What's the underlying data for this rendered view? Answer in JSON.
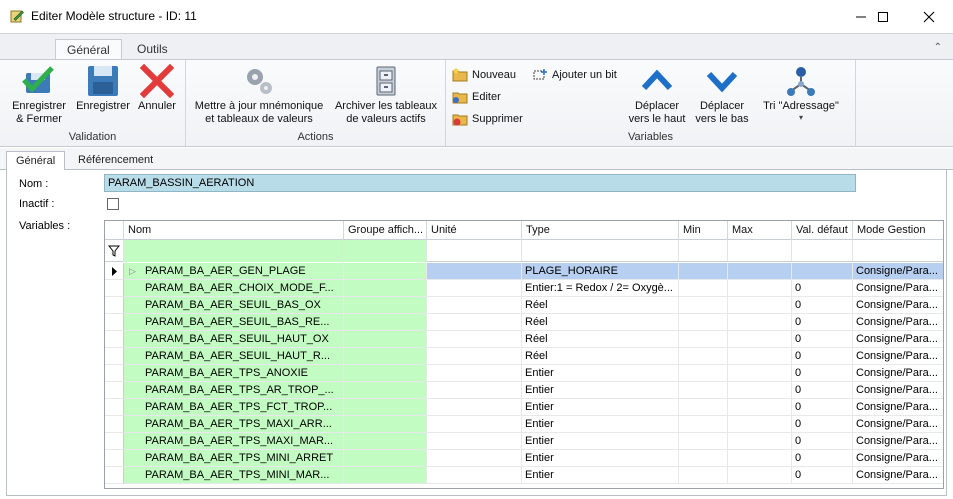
{
  "window": {
    "title": "Editer Modèle structure - ID: 11"
  },
  "ribbon": {
    "tabs": [
      "Général",
      "Outils"
    ],
    "groups": {
      "validation": {
        "label": "Validation",
        "save_close": "Enregistrer\n& Fermer",
        "save": "Enregistrer",
        "cancel": "Annuler"
      },
      "actions": {
        "label": "Actions",
        "update": "Mettre à jour mnémonique\net tableaux de valeurs",
        "archive": "Archiver les tableaux\nde valeurs actifs"
      },
      "variables": {
        "label": "Variables",
        "new": "Nouveau",
        "edit": "Editer",
        "delete": "Supprimer",
        "add_bit": "Ajouter un bit",
        "move_up": "Déplacer\nvers le haut",
        "move_down": "Déplacer\nvers le bas",
        "sort": "Tri \"Adressage\""
      }
    }
  },
  "subtabs": [
    "Général",
    "Référencement"
  ],
  "form": {
    "name_label": "Nom :",
    "name_value": "PARAM_BASSIN_AERATION",
    "inactive_label": "Inactif :",
    "variables_label": "Variables :"
  },
  "grid": {
    "columns": [
      "Nom",
      "Groupe affich...",
      "Unité",
      "Type",
      "Min",
      "Max",
      "Val. défaut",
      "Mode Gestion"
    ],
    "rows": [
      {
        "nom": "PARAM_BA_AER_GEN_PLAGE",
        "groupe": "",
        "unite": "",
        "type": "PLAGE_HORAIRE",
        "min": "",
        "max": "",
        "defaut": "",
        "mode": "Consigne/Para..."
      },
      {
        "nom": "PARAM_BA_AER_CHOIX_MODE_F...",
        "groupe": "",
        "unite": "",
        "type": "Entier:1 = Redox / 2= Oxygè...",
        "min": "",
        "max": "",
        "defaut": "0",
        "mode": "Consigne/Para..."
      },
      {
        "nom": "PARAM_BA_AER_SEUIL_BAS_OX",
        "groupe": "",
        "unite": "",
        "type": "Réel",
        "min": "",
        "max": "",
        "defaut": "0",
        "mode": "Consigne/Para..."
      },
      {
        "nom": "PARAM_BA_AER_SEUIL_BAS_RE...",
        "groupe": "",
        "unite": "",
        "type": "Réel",
        "min": "",
        "max": "",
        "defaut": "0",
        "mode": "Consigne/Para..."
      },
      {
        "nom": "PARAM_BA_AER_SEUIL_HAUT_OX",
        "groupe": "",
        "unite": "",
        "type": "Réel",
        "min": "",
        "max": "",
        "defaut": "0",
        "mode": "Consigne/Para..."
      },
      {
        "nom": "PARAM_BA_AER_SEUIL_HAUT_R...",
        "groupe": "",
        "unite": "",
        "type": "Réel",
        "min": "",
        "max": "",
        "defaut": "0",
        "mode": "Consigne/Para..."
      },
      {
        "nom": "PARAM_BA_AER_TPS_ANOXIE",
        "groupe": "",
        "unite": "",
        "type": "Entier",
        "min": "",
        "max": "",
        "defaut": "0",
        "mode": "Consigne/Para..."
      },
      {
        "nom": "PARAM_BA_AER_TPS_AR_TROP_...",
        "groupe": "",
        "unite": "",
        "type": "Entier",
        "min": "",
        "max": "",
        "defaut": "0",
        "mode": "Consigne/Para..."
      },
      {
        "nom": "PARAM_BA_AER_TPS_FCT_TROP...",
        "groupe": "",
        "unite": "",
        "type": "Entier",
        "min": "",
        "max": "",
        "defaut": "0",
        "mode": "Consigne/Para..."
      },
      {
        "nom": "PARAM_BA_AER_TPS_MAXI_ARR...",
        "groupe": "",
        "unite": "",
        "type": "Entier",
        "min": "",
        "max": "",
        "defaut": "0",
        "mode": "Consigne/Para..."
      },
      {
        "nom": "PARAM_BA_AER_TPS_MAXI_MAR...",
        "groupe": "",
        "unite": "",
        "type": "Entier",
        "min": "",
        "max": "",
        "defaut": "0",
        "mode": "Consigne/Para..."
      },
      {
        "nom": "PARAM_BA_AER_TPS_MINI_ARRET",
        "groupe": "",
        "unite": "",
        "type": "Entier",
        "min": "",
        "max": "",
        "defaut": "0",
        "mode": "Consigne/Para..."
      },
      {
        "nom": "PARAM_BA_AER_TPS_MINI_MAR...",
        "groupe": "",
        "unite": "",
        "type": "Entier",
        "min": "",
        "max": "",
        "defaut": "0",
        "mode": "Consigne/Para..."
      }
    ]
  },
  "colors": {
    "name_highlight": "#b8dde8",
    "green_cell": "#c3fcc3",
    "selected_row": "#b7cff0",
    "accent_blue": "#1e6fc7"
  }
}
